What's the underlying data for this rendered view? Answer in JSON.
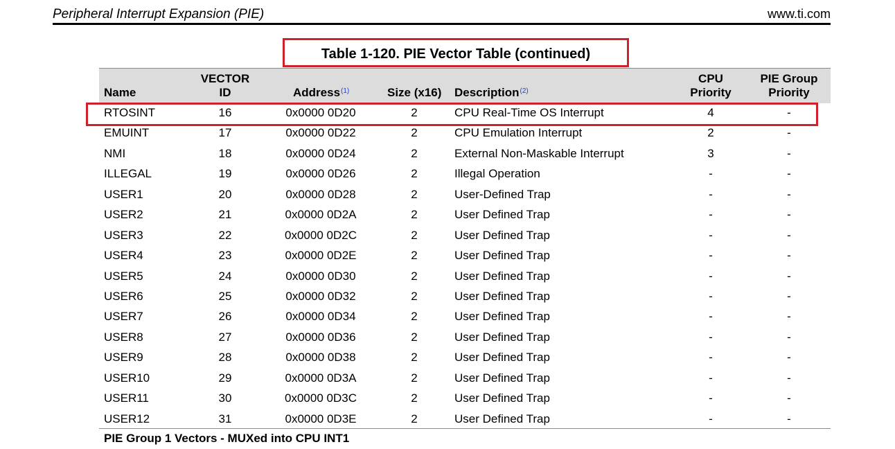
{
  "header": {
    "left": "Peripheral Interrupt Expansion (PIE)",
    "right": "www.ti.com"
  },
  "table": {
    "title": "Table 1-120.  PIE Vector Table (continued)",
    "columns": {
      "name": "Name",
      "vector_line1": "VECTOR",
      "vector_line2": "ID",
      "address": "Address",
      "address_note": "(1)",
      "size": "Size (x16)",
      "description": "Description",
      "description_note": "(2)",
      "cpu_line1": "CPU",
      "cpu_line2": "Priority",
      "pie_line1": "PIE Group",
      "pie_line2": "Priority"
    },
    "rows": [
      {
        "name": "RTOSINT",
        "vector": "16",
        "address": "0x0000 0D20",
        "size": "2",
        "description": "CPU Real-Time OS Interrupt",
        "cpu": "4",
        "pie": "-"
      },
      {
        "name": "EMUINT",
        "vector": "17",
        "address": "0x0000 0D22",
        "size": "2",
        "description": "CPU Emulation Interrupt",
        "cpu": "2",
        "pie": "-"
      },
      {
        "name": "NMI",
        "vector": "18",
        "address": "0x0000 0D24",
        "size": "2",
        "description": "External Non-Maskable Interrupt",
        "cpu": "3",
        "pie": "-"
      },
      {
        "name": "ILLEGAL",
        "vector": "19",
        "address": "0x0000 0D26",
        "size": "2",
        "description": "Illegal Operation",
        "cpu": "-",
        "pie": "-"
      },
      {
        "name": "USER1",
        "vector": "20",
        "address": "0x0000 0D28",
        "size": "2",
        "description": "User-Defined Trap",
        "cpu": "-",
        "pie": "-"
      },
      {
        "name": "USER2",
        "vector": "21",
        "address": "0x0000 0D2A",
        "size": "2",
        "description": "User Defined Trap",
        "cpu": "-",
        "pie": "-"
      },
      {
        "name": "USER3",
        "vector": "22",
        "address": "0x0000 0D2C",
        "size": "2",
        "description": "User Defined Trap",
        "cpu": "-",
        "pie": "-"
      },
      {
        "name": "USER4",
        "vector": "23",
        "address": "0x0000 0D2E",
        "size": "2",
        "description": "User Defined Trap",
        "cpu": "-",
        "pie": "-"
      },
      {
        "name": "USER5",
        "vector": "24",
        "address": "0x0000 0D30",
        "size": "2",
        "description": "User Defined Trap",
        "cpu": "-",
        "pie": "-"
      },
      {
        "name": "USER6",
        "vector": "25",
        "address": "0x0000 0D32",
        "size": "2",
        "description": "User Defined Trap",
        "cpu": "-",
        "pie": "-"
      },
      {
        "name": "USER7",
        "vector": "26",
        "address": "0x0000 0D34",
        "size": "2",
        "description": "User Defined Trap",
        "cpu": "-",
        "pie": "-"
      },
      {
        "name": "USER8",
        "vector": "27",
        "address": "0x0000 0D36",
        "size": "2",
        "description": "User Defined Trap",
        "cpu": "-",
        "pie": "-"
      },
      {
        "name": "USER9",
        "vector": "28",
        "address": "0x0000 0D38",
        "size": "2",
        "description": "User Defined Trap",
        "cpu": "-",
        "pie": "-"
      },
      {
        "name": "USER10",
        "vector": "29",
        "address": "0x0000 0D3A",
        "size": "2",
        "description": "User Defined Trap",
        "cpu": "-",
        "pie": "-"
      },
      {
        "name": "USER11",
        "vector": "30",
        "address": "0x0000 0D3C",
        "size": "2",
        "description": "User Defined Trap",
        "cpu": "-",
        "pie": "-"
      },
      {
        "name": "USER12",
        "vector": "31",
        "address": "0x0000 0D3E",
        "size": "2",
        "description": "User Defined Trap",
        "cpu": "-",
        "pie": "-"
      }
    ],
    "footer": "PIE Group 1 Vectors - MUXed into CPU INT1"
  },
  "colors": {
    "highlight": "#d0202a",
    "header_bg": "#dcdcdc",
    "footnote_link": "#1a3fcf"
  }
}
